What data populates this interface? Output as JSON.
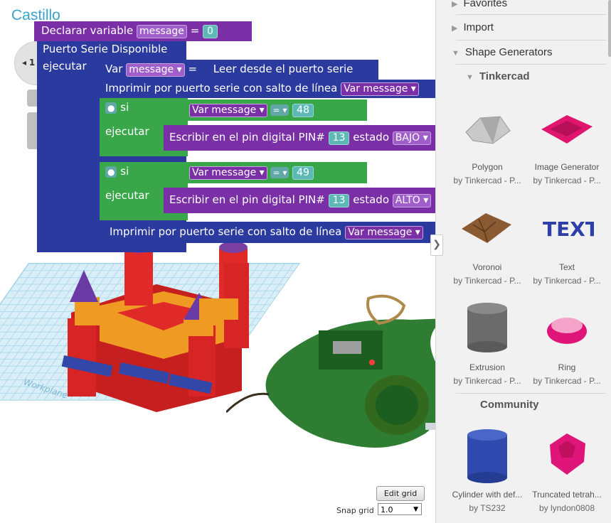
{
  "project": {
    "title": "Castillo"
  },
  "nav": {
    "zoom_indicator": "1"
  },
  "workplane": {
    "label": "Workplane"
  },
  "grid_controls": {
    "edit_grid": "Edit grid",
    "snap_label": "Snap grid",
    "snap_value": "1.0"
  },
  "blocks": {
    "declare": {
      "label": "Declarar variable",
      "var": "message",
      "eq": "=",
      "value": "0"
    },
    "serial": {
      "label": "Puerto Serie Disponible",
      "exec": "ejecutar"
    },
    "assign": {
      "var_kw": "Var",
      "var": "message ▾",
      "eq": "=",
      "read": "Leer desde el puerto serie"
    },
    "print1": {
      "label": "Imprimir por puerto serie con salto de línea",
      "var_kw": "Var",
      "var": "message ▾"
    },
    "if1": {
      "si": "si",
      "exec": "ejecutar",
      "var_kw": "Var",
      "var": "message ▾",
      "op": "= ▾",
      "value": "48",
      "write": "Escribir en el pin digital",
      "pin": "PIN#",
      "pin_value": "13",
      "state_label": "estado",
      "state": "BAJO ▾"
    },
    "if2": {
      "si": "si",
      "exec": "ejecutar",
      "var_kw": "Var",
      "var": "message ▾",
      "op": "= ▾",
      "value": "49",
      "write": "Escribir en el pin digital",
      "pin": "PIN#",
      "pin_value": "13",
      "state_label": "estado",
      "state": "ALTO ▾"
    },
    "print2": {
      "label": "Imprimir por puerto serie con salto de línea",
      "var_kw": "Var",
      "var": "message ▾"
    }
  },
  "sidebar": {
    "favorites": "Favorites",
    "import": "Import",
    "shape_generators": "Shape Generators",
    "tinkercad": "Tinkercad",
    "community": "Community",
    "collapse_glyph": "❯",
    "items": [
      {
        "name": "Polygon",
        "by": "by Tinkercad - P..."
      },
      {
        "name": "Image Generator",
        "by": "by Tinkercad - P..."
      },
      {
        "name": "Voronoi",
        "by": "by Tinkercad - P..."
      },
      {
        "name": "Text",
        "by": "by Tinkercad - P..."
      },
      {
        "name": "Extrusion",
        "by": "by Tinkercad - P..."
      },
      {
        "name": "Ring",
        "by": "by Tinkercad - P..."
      },
      {
        "name": "Cylinder with def...",
        "by": "by TS232"
      },
      {
        "name": "Truncated tetrah...",
        "by": "by lyndon0808"
      }
    ]
  },
  "colors": {
    "block_navy": "#2b3a9e",
    "block_purple": "#7a2fa6",
    "block_green": "#3aa64a",
    "castle_red": "#e02a2a",
    "title_blue": "#3aa3c9"
  }
}
